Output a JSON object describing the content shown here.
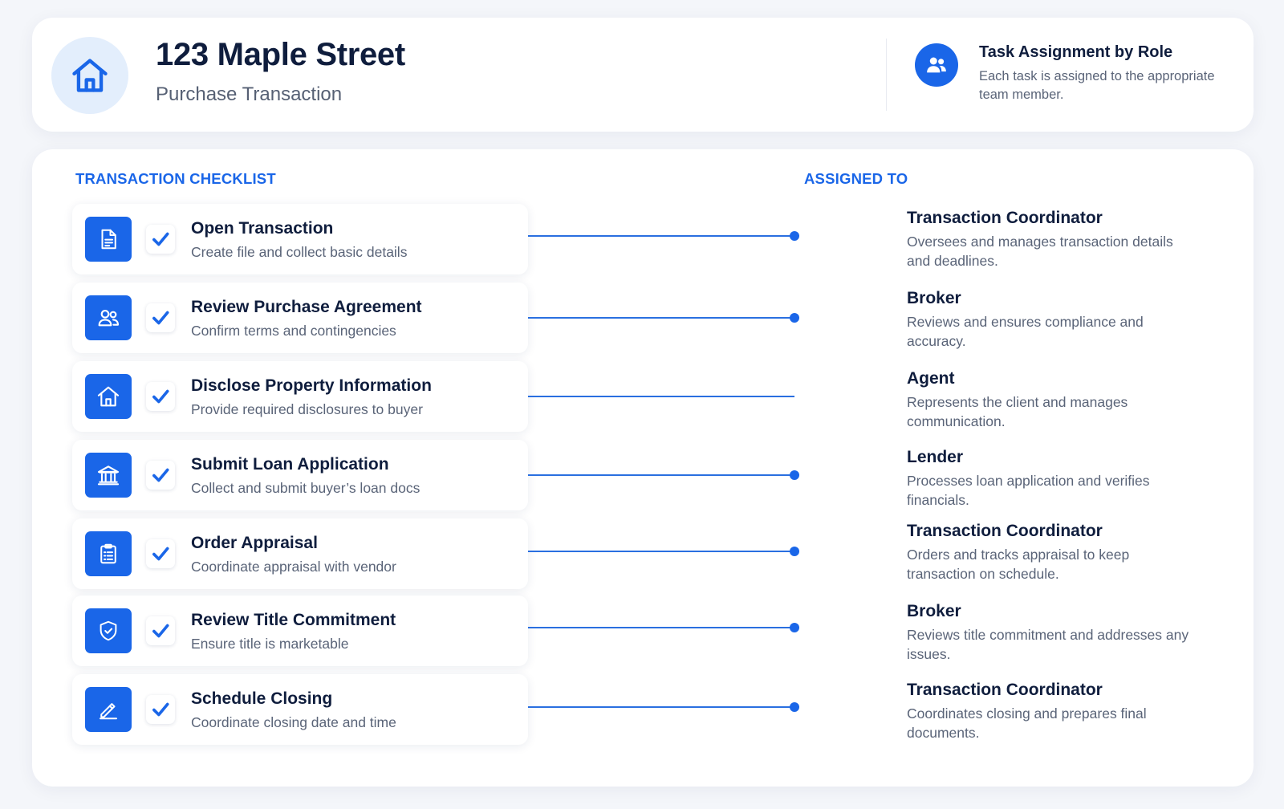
{
  "header": {
    "title": "123 Maple Street",
    "subtitle": "Purchase Transaction",
    "icon": "house-icon",
    "info": {
      "icon": "users-icon",
      "title": "Task Assignment by Role",
      "description": "Each task is assigned to the appropriate team member."
    }
  },
  "checklist": {
    "heading": "TRANSACTION CHECKLIST",
    "assigned_heading": "ASSIGNED TO",
    "tasks": [
      {
        "title": "Open Transaction",
        "description": "Create file and collect basic details",
        "icon": "document-icon",
        "checked": true,
        "assignee_role": "Transaction Coordinator",
        "assignee_description": "Oversees and manages transaction details and deadlines."
      },
      {
        "title": "Review Purchase Agreement",
        "description": "Confirm terms and contingencies",
        "icon": "users-icon",
        "checked": true,
        "assignee_role": "Broker",
        "assignee_description": "Reviews and ensures compliance and accuracy."
      },
      {
        "title": "Disclose Property Information",
        "description": "Provide required disclosures to buyer",
        "icon": "house-icon",
        "checked": true,
        "assignee_role": "Agent",
        "assignee_description": "Represents the client and manages communication."
      },
      {
        "title": "Submit Loan Application",
        "description": "Collect and submit buyer’s loan docs",
        "icon": "bank-icon",
        "checked": true,
        "assignee_role": "Lender",
        "assignee_description": "Processes loan application and verifies financials."
      },
      {
        "title": "Order Appraisal",
        "description": "Coordinate appraisal with vendor",
        "icon": "clipboard-icon",
        "checked": true,
        "assignee_role": "Transaction Coordinator",
        "assignee_description": "Orders and tracks appraisal to keep transaction on schedule."
      },
      {
        "title": "Review Title Commitment",
        "description": "Ensure title is marketable",
        "icon": "shield-icon",
        "checked": true,
        "assignee_role": "Broker",
        "assignee_description": "Reviews title commitment and addresses any issues."
      },
      {
        "title": "Schedule Closing",
        "description": "Coordinate closing date and time",
        "icon": "pen-icon",
        "checked": true,
        "assignee_role": "Transaction Coordinator",
        "assignee_description": "Coordinates closing and prepares final documents."
      }
    ]
  },
  "colors": {
    "accent": "#1a66e8",
    "title_text": "#0f1d3d",
    "body_text": "#5a6478",
    "icon_badge_bg": "#e3eefc",
    "page_bg": "#f4f6fa"
  }
}
